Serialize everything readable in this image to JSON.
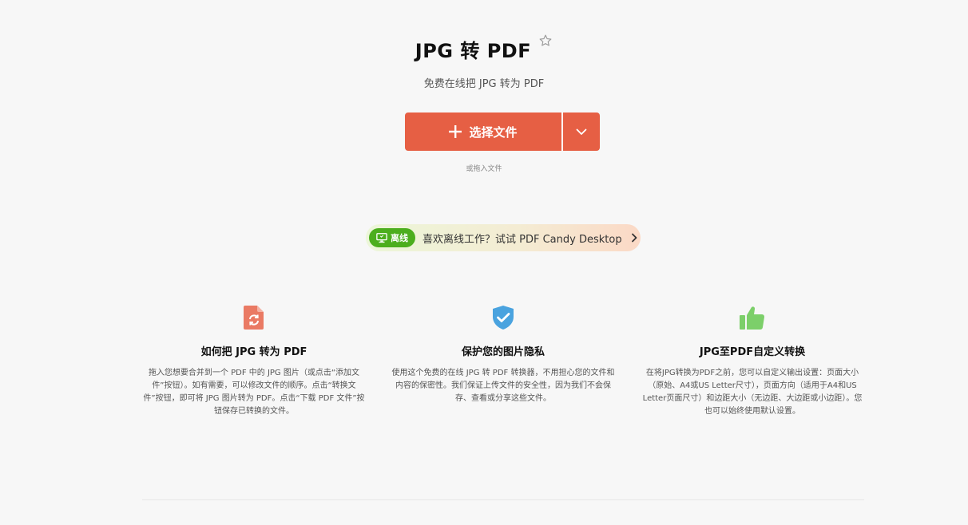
{
  "header": {
    "title": "JPG 转 PDF",
    "subtitle": "免费在线把 JPG 转为 PDF"
  },
  "upload": {
    "choose_label": "选择文件",
    "drop_hint": "或拖入文件"
  },
  "promo": {
    "badge": "离线",
    "text": "喜欢离线工作？试试 PDF Candy Desktop"
  },
  "features": [
    {
      "title": "如何把 JPG 转为 PDF",
      "desc": "拖入您想要合并到一个 PDF 中的 JPG 图片（或点击“添加文件”按钮）。如有需要，可以修改文件的顺序。点击“转换文件”按钮，即可将 JPG 图片转为 PDF。点击“下载 PDF 文件”按钮保存已转换的文件。"
    },
    {
      "title": "保护您的图片隐私",
      "desc": "使用这个免费的在线 JPG 转 PDF 转换器，不用担心您的文件和内容的保密性。我们保证上传文件的安全性，因为我们不会保存、查看或分享这些文件。"
    },
    {
      "title": "JPG至PDF自定义转换",
      "desc": "在将JPG转换为PDF之前，您可以自定义输出设置：页面大小（原始、A4或US Letter尺寸），页面方向（适用于A4和US Letter页面尺寸）和边距大小（无边距、大边距或小边距）。您也可以始终使用默认设置。"
    }
  ],
  "colors": {
    "accent": "#e65f44",
    "badge_green": "#4cae1d",
    "shield_blue": "#4aa3df",
    "thumb_green": "#7ccf6a"
  }
}
